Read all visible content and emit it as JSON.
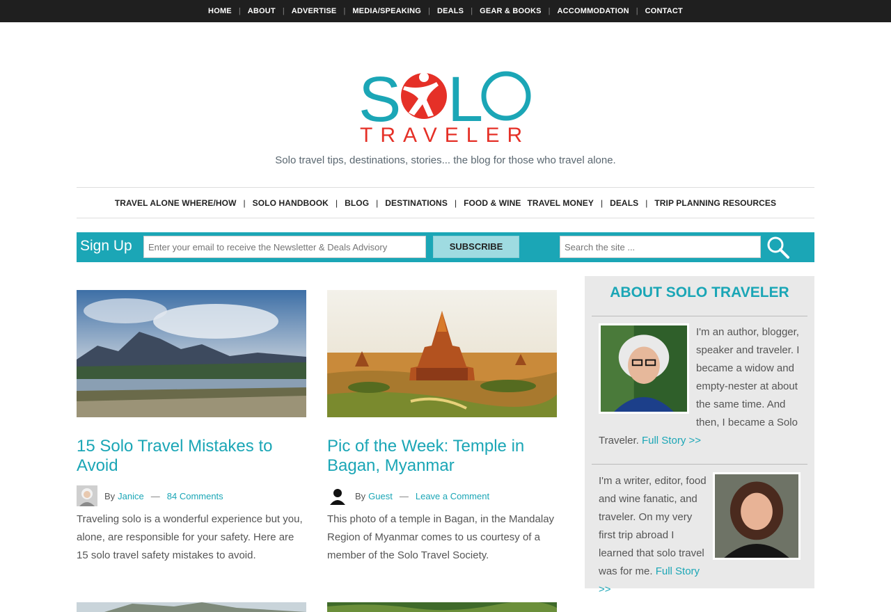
{
  "topnav": [
    "HOME",
    "ABOUT",
    "ADVERTISE",
    "MEDIA/SPEAKING",
    "DEALS",
    "GEAR & BOOKS",
    "ACCOMMODATION",
    "CONTACT"
  ],
  "logo": {
    "line1": "SOLO",
    "line2": "TRAVELER",
    "teal": "#1ba6b6",
    "red": "#e53027"
  },
  "tagline": "Solo travel tips, destinations, stories... the blog for those who travel alone.",
  "mainnav": [
    "TRAVEL ALONE WHERE/HOW",
    "SOLO HANDBOOK",
    "BLOG",
    "DESTINATIONS",
    "FOOD & WINE",
    "TRAVEL MONEY",
    "DEALS",
    "TRIP PLANNING RESOURCES"
  ],
  "signup": {
    "label": "Sign Up",
    "email_placeholder": "Enter your email to receive the Newsletter & Deals Advisory",
    "button": "SUBSCRIBE",
    "search_placeholder": "Search the site ...",
    "search_icon": "magnifier-icon"
  },
  "posts": [
    {
      "title": "15 Solo Travel Mistakes to Avoid",
      "by": "By",
      "author": "Janice",
      "comments": "84 Comments",
      "excerpt": "Traveling solo is a wonderful experience but you, alone, are responsible for your safety. Here are 15 solo travel safety mistakes to avoid."
    },
    {
      "title": "Pic of the Week: Temple in Bagan, Myanmar",
      "by": "By",
      "author": "Guest",
      "comments": "Leave a Comment",
      "excerpt": "This photo of a temple in Bagan, in the Mandalay Region of Myanmar comes to us courtesy of a member of the Solo Travel Society."
    }
  ],
  "sidebar": {
    "title": "ABOUT SOLO TRAVELER",
    "bio1": "I'm an author, blogger, speaker and traveler. I became a widow and empty-nester at about the same time. And then, I became a Solo Traveler.",
    "bio1_link": "Full Story >>",
    "bio2": "I'm a writer, editor, food and wine fanatic, and traveler. On my very first trip abroad I learned that solo travel was for me.",
    "bio2_link": "Full Story >>"
  },
  "colors": {
    "accent": "#1ba6b6",
    "topbar": "#1f1f1f",
    "sidebar_bg": "#e9e9e9",
    "subscribe_bg": "#9fdbe1"
  }
}
